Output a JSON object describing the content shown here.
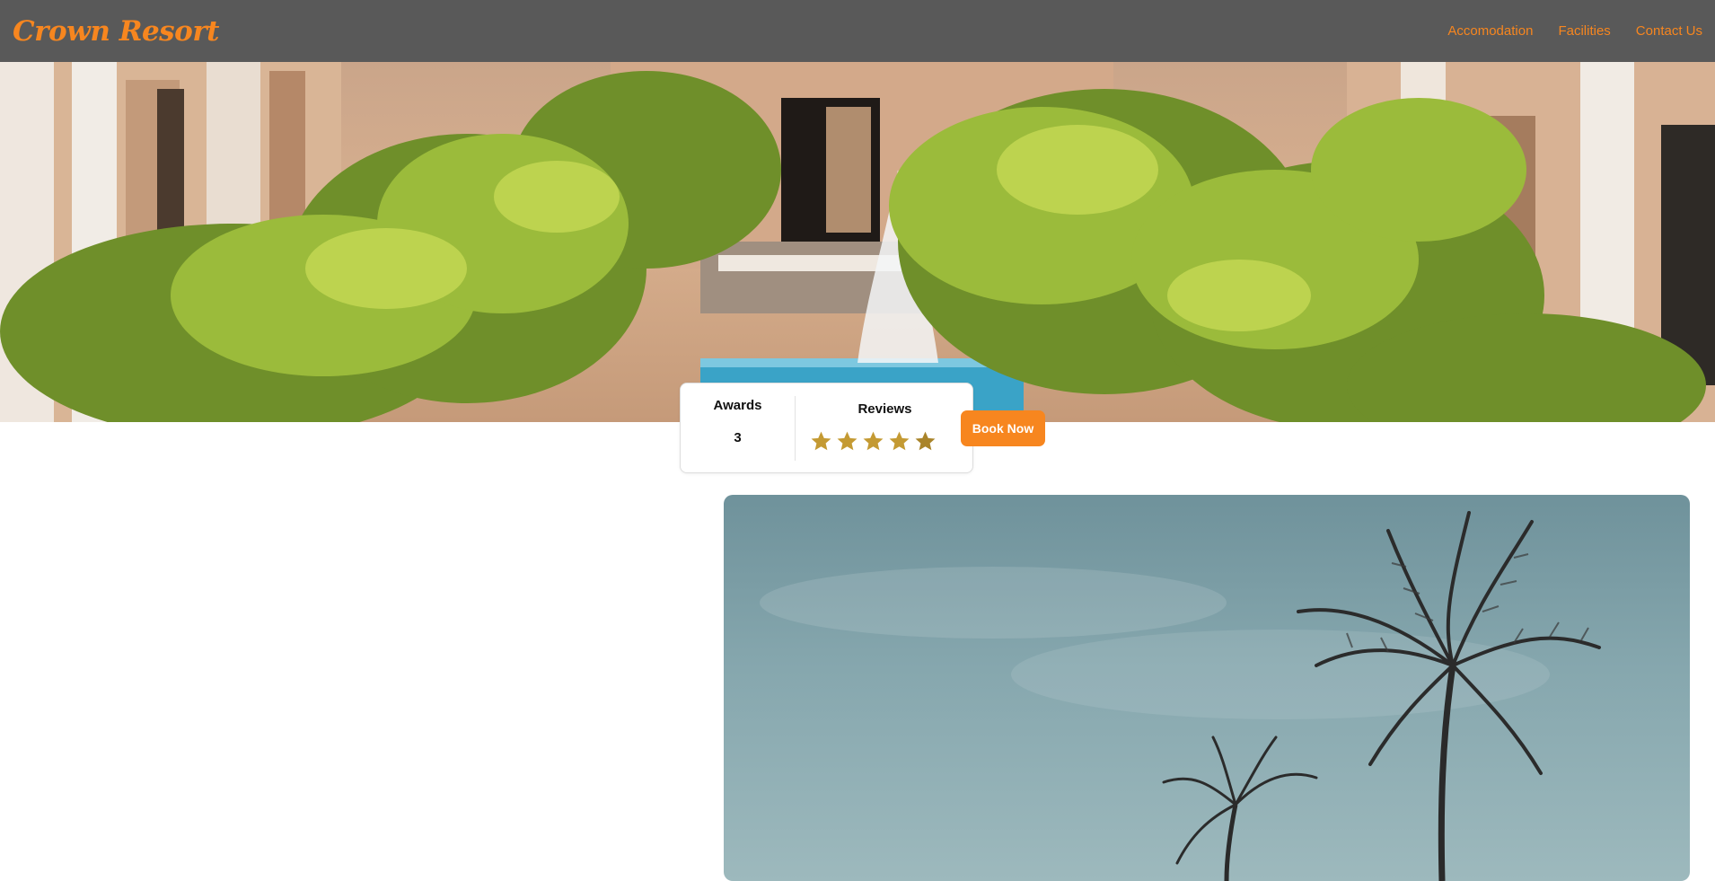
{
  "navbar": {
    "brand": "Crown Resort",
    "links": [
      "Accomodation",
      "Facilities",
      "Contact Us"
    ]
  },
  "stats": {
    "awards_label": "Awards",
    "awards_value": "3",
    "reviews_label": "Reviews",
    "rating": 5,
    "rating_max": 5
  },
  "book_button": {
    "label": "Book Now"
  },
  "icons": {
    "star": "star-icon"
  },
  "colors": {
    "accent": "#f7861f",
    "navbar_bg": "#595959",
    "star": "#c49a33"
  }
}
